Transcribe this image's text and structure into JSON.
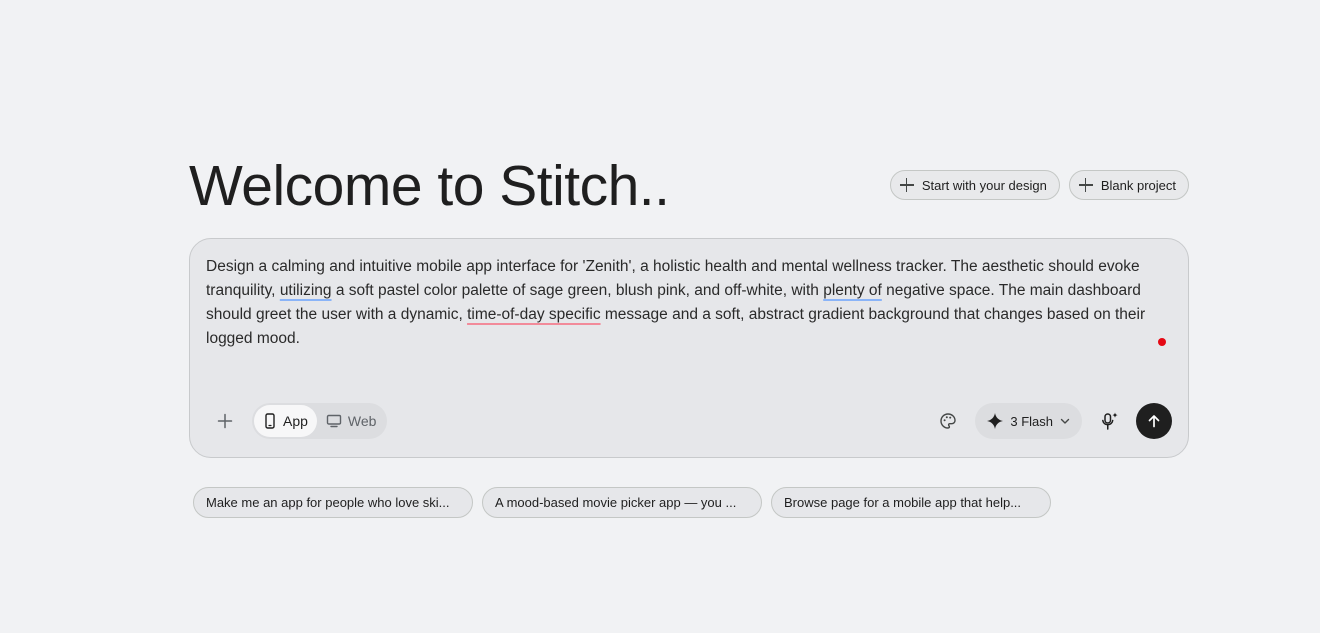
{
  "header": {
    "title": "Welcome to Stitch.."
  },
  "actions": {
    "start_with_design": "Start with your design",
    "blank_project": "Blank project"
  },
  "prompt": {
    "p1": "Design a calming and intuitive mobile app interface for 'Zenith', a holistic health and mental wellness tracker. The aesthetic should evoke tranquility, ",
    "w1": "utilizing",
    "p2": " a soft pastel color palette of sage green, blush pink, and off-white, with ",
    "w2": "plenty of",
    "p3": " negative space. The main dashboard should greet the user with a dynamic, ",
    "w3": "time-of-day specific",
    "p4": " message and a soft, abstract gradient background that changes based on their logged mood."
  },
  "toolbar": {
    "add_icon": "plus-icon",
    "modes": [
      {
        "label": "App",
        "icon": "phone-icon",
        "active": true
      },
      {
        "label": "Web",
        "icon": "monitor-icon",
        "active": false
      }
    ],
    "palette_icon": "palette-icon",
    "model_label": "3 Flash",
    "mic_icon": "mic-sparkle-icon",
    "send_icon": "arrow-up-icon"
  },
  "suggestions": [
    "Make me an app for people who love ski...",
    "A mood-based movie picker app — you ...",
    "Browse page for a mobile app that help..."
  ],
  "colors": {
    "background": "#f1f2f4",
    "send_button": "#1f1f1f",
    "recording_dot": "#e50914"
  }
}
